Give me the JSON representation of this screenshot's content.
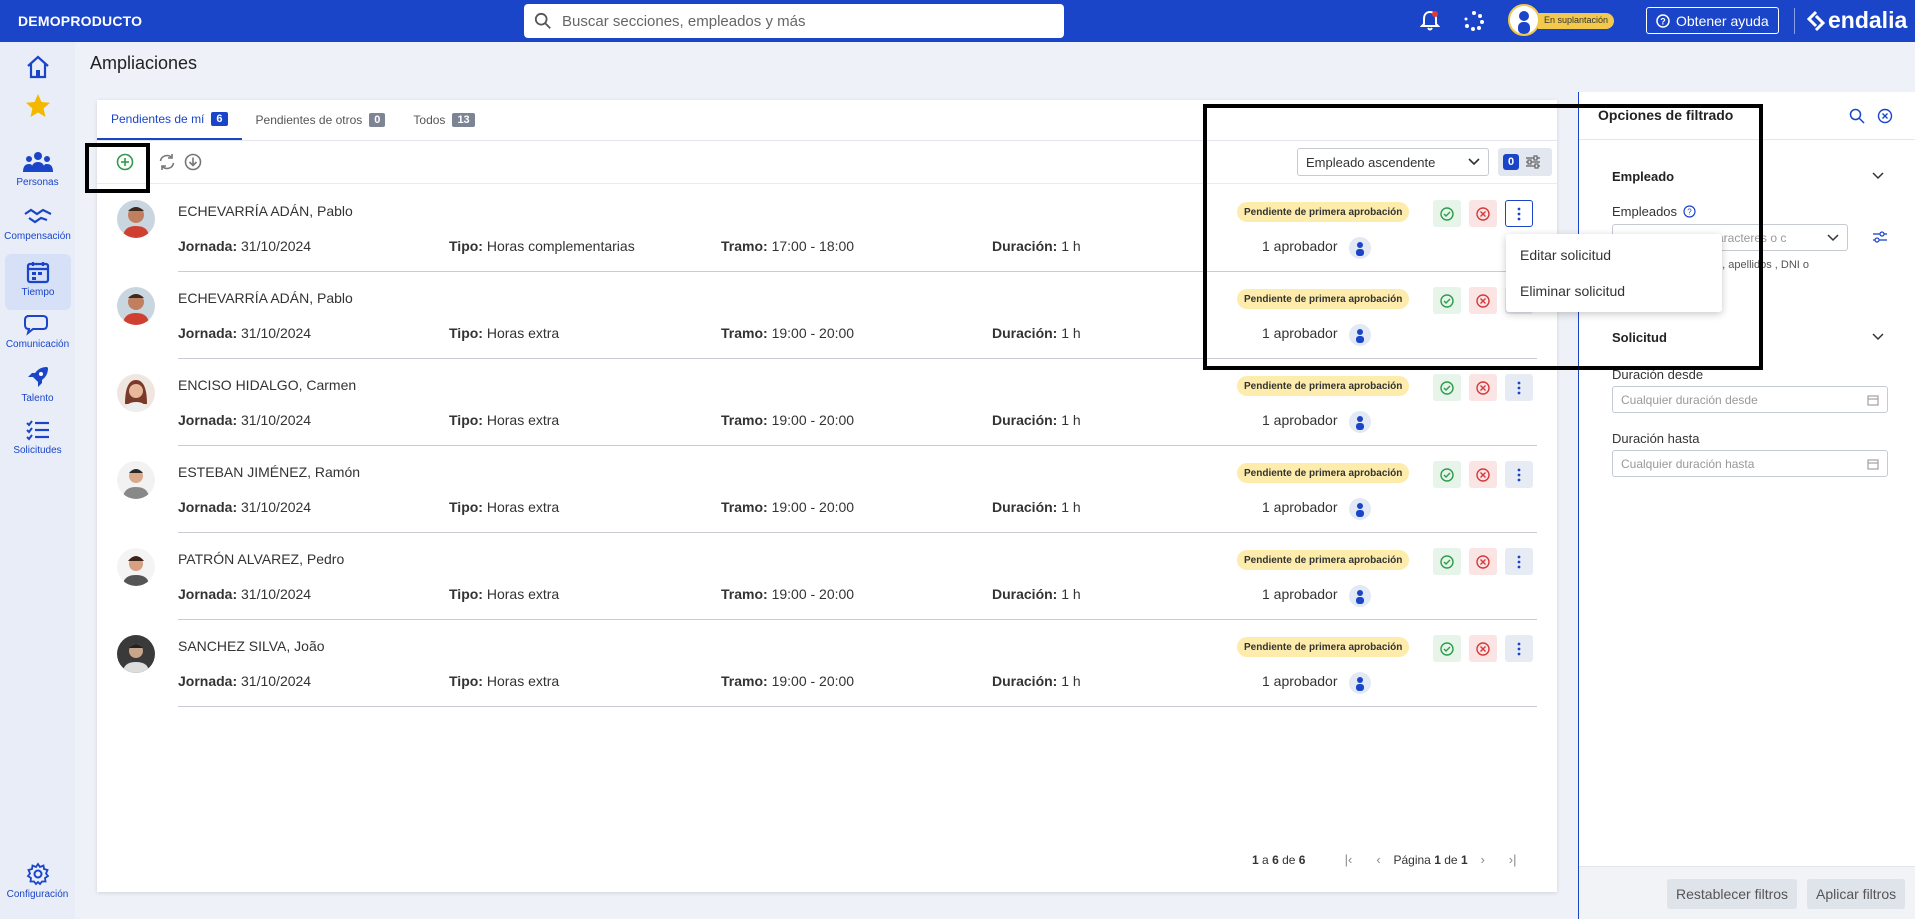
{
  "topbar": {
    "brand": "DEMOPRODUCTO",
    "search_placeholder": "Buscar secciones, empleados y más",
    "impersonation_badge": "En suplantación",
    "help_label": "Obtener ayuda",
    "logo_text": "endalia"
  },
  "sidebar": {
    "items": [
      {
        "label": "",
        "icon": "home-icon"
      },
      {
        "label": "",
        "icon": "star-icon"
      },
      {
        "label": "Personas",
        "icon": "people-icon"
      },
      {
        "label": "Compensación",
        "icon": "handshake-icon"
      },
      {
        "label": "Tiempo",
        "icon": "calendar-icon"
      },
      {
        "label": "Comunicación",
        "icon": "chat-icon"
      },
      {
        "label": "Talento",
        "icon": "rocket-icon"
      },
      {
        "label": "Solicitudes",
        "icon": "checklist-icon"
      },
      {
        "label": "Configuración",
        "icon": "gear-icon"
      }
    ]
  },
  "page": {
    "title": "Ampliaciones"
  },
  "tabs": [
    {
      "label": "Pendientes de mí",
      "count": "6"
    },
    {
      "label": "Pendientes de otros",
      "count": "0"
    },
    {
      "label": "Todos",
      "count": "13"
    }
  ],
  "toolbar": {
    "sort_value": "Empleado ascendente",
    "filter_count": "0"
  },
  "field_labels": {
    "jornada": "Jornada:",
    "tipo": "Tipo:",
    "tramo": "Tramo:",
    "duracion": "Duración:"
  },
  "rows": [
    {
      "name": "ECHEVARRÍA ADÁN, Pablo",
      "jornada": "31/10/2024",
      "tipo": "Horas complementarias",
      "tramo": "17:00 - 18:00",
      "duracion": "1 h",
      "status": "Pendiente de primera aprobación",
      "approvers": "1 aprobador"
    },
    {
      "name": "ECHEVARRÍA ADÁN, Pablo",
      "jornada": "31/10/2024",
      "tipo": "Horas extra",
      "tramo": "19:00 - 20:00",
      "duracion": "1 h",
      "status": "Pendiente de primera aprobación",
      "approvers": "1 aprobador"
    },
    {
      "name": "ENCISO HIDALGO, Carmen",
      "jornada": "31/10/2024",
      "tipo": "Horas extra",
      "tramo": "19:00 - 20:00",
      "duracion": "1 h",
      "status": "Pendiente de primera aprobación",
      "approvers": "1 aprobador"
    },
    {
      "name": "ESTEBAN JIMÉNEZ, Ramón",
      "jornada": "31/10/2024",
      "tipo": "Horas extra",
      "tramo": "19:00 - 20:00",
      "duracion": "1 h",
      "status": "Pendiente de primera aprobación",
      "approvers": "1 aprobador"
    },
    {
      "name": "PATRÓN ALVAREZ, Pedro",
      "jornada": "31/10/2024",
      "tipo": "Horas extra",
      "tramo": "19:00 - 20:00",
      "duracion": "1 h",
      "status": "Pendiente de primera aprobación",
      "approvers": "1 aprobador"
    },
    {
      "name": "SANCHEZ SILVA, João",
      "jornada": "31/10/2024",
      "tipo": "Horas extra",
      "tramo": "19:00 - 20:00",
      "duracion": "1 h",
      "status": "Pendiente de primera aprobación",
      "approvers": "1 aprobador"
    }
  ],
  "context_menu": {
    "edit": "Editar solicitud",
    "delete": "Eliminar solicitud"
  },
  "pager": {
    "range_from": "1",
    "a": "a",
    "range_to": "6",
    "de": "de",
    "total": "6",
    "page_label": "Página",
    "page": "1",
    "of": "de",
    "pages": "1"
  },
  "filter_panel": {
    "title": "Opciones de filtrado",
    "section_employee": "Empleado",
    "employees_label": "Empleados",
    "employees_placeholder": "o caracteres o c",
    "employees_hint": "ombre, apellidos , DNI o",
    "section_request": "Solicitud",
    "duration_from_label": "Duración desde",
    "duration_from_placeholder": "Cualquier duración desde",
    "duration_to_label": "Duración hasta",
    "duration_to_placeholder": "Cualquier duración hasta",
    "reset_label": "Restablecer filtros",
    "apply_label": "Aplicar filtros"
  },
  "colors": {
    "primary": "#1a45c9",
    "pending_badge": "#fdecab",
    "approve": "#2e9c4a",
    "reject": "#d33a3a"
  }
}
